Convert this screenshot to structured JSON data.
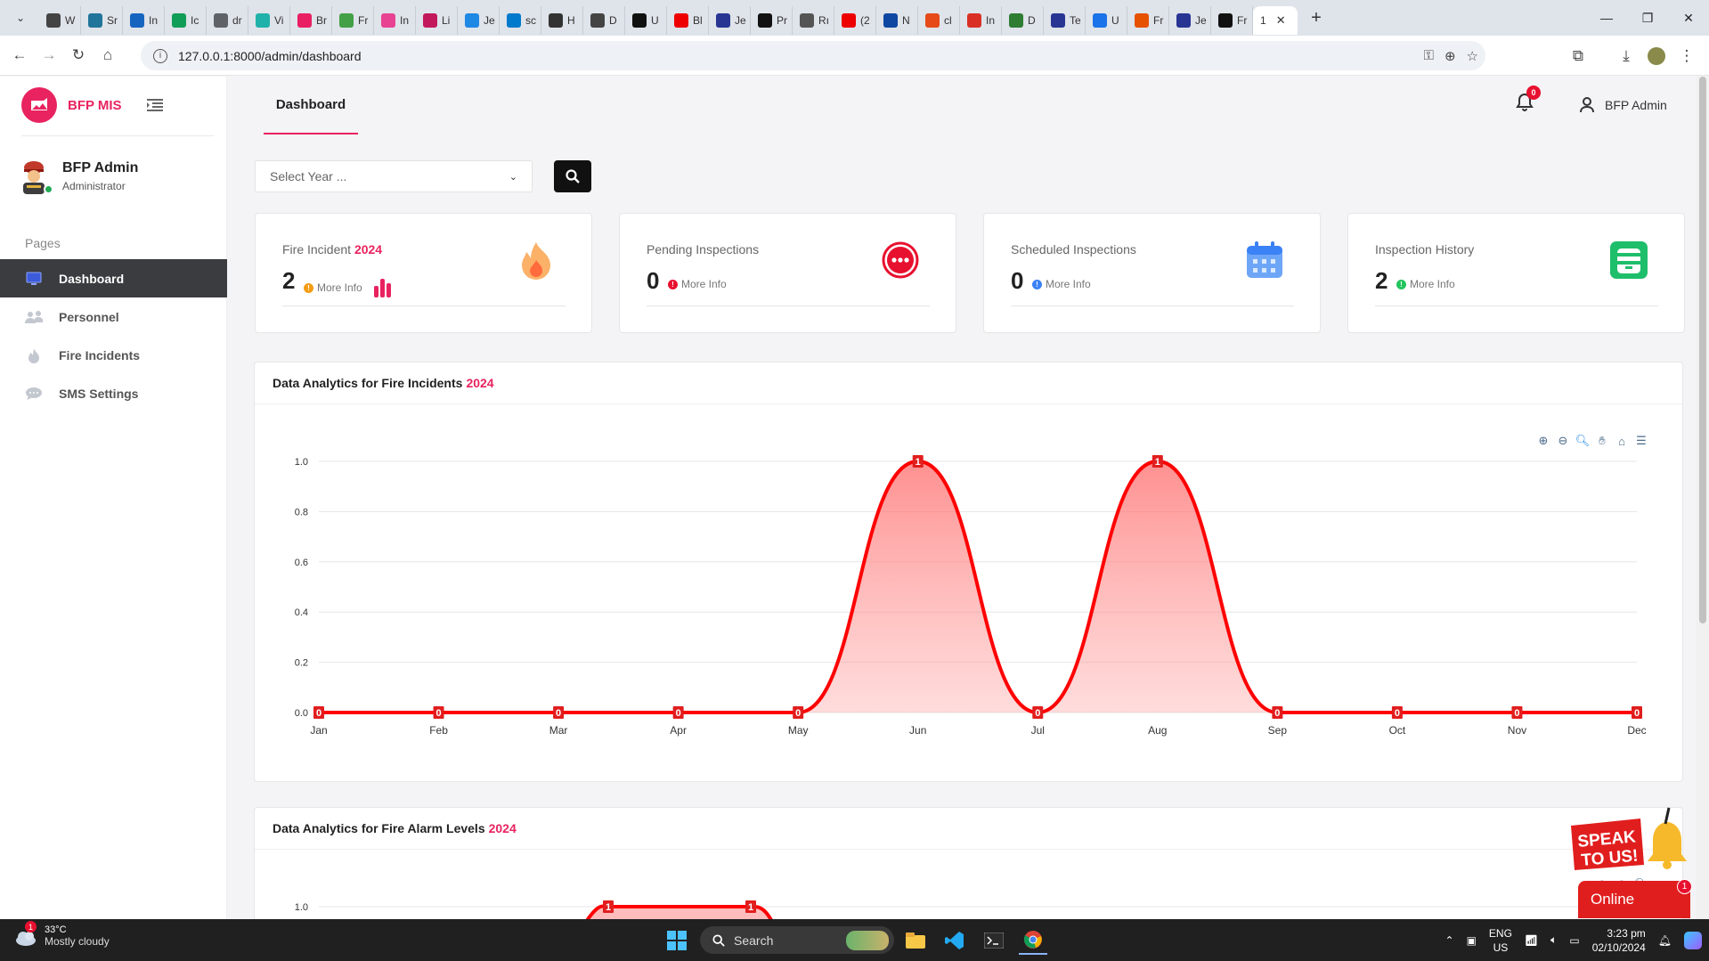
{
  "browser": {
    "tabs": [
      {
        "label": "W",
        "color": "#444"
      },
      {
        "label": "Sr",
        "color": "#21759b"
      },
      {
        "label": "In",
        "color": "#1565c0"
      },
      {
        "label": "Ic",
        "color": "#0f9d58"
      },
      {
        "label": "dr",
        "color": "#5f6368"
      },
      {
        "label": "Vi",
        "color": "#20b2aa"
      },
      {
        "label": "Br",
        "color": "#e91e63"
      },
      {
        "label": "Fr",
        "color": "#43a047"
      },
      {
        "label": "In",
        "color": "#e84393"
      },
      {
        "label": "Li",
        "color": "#c2185b"
      },
      {
        "label": "Je",
        "color": "#1e88e5"
      },
      {
        "label": "sc",
        "color": "#007acc"
      },
      {
        "label": "H",
        "color": "#333"
      },
      {
        "label": "D",
        "color": "#444"
      },
      {
        "label": "U",
        "color": "#111"
      },
      {
        "label": "Bl",
        "color": "#e00"
      },
      {
        "label": "Je",
        "color": "#283593"
      },
      {
        "label": "Pr",
        "color": "#111"
      },
      {
        "label": "Rı",
        "color": "#555"
      },
      {
        "label": "(2",
        "color": "#e00"
      },
      {
        "label": "N",
        "color": "#0d47a1"
      },
      {
        "label": "cl",
        "color": "#e64a19"
      },
      {
        "label": "In",
        "color": "#d93025"
      },
      {
        "label": "D",
        "color": "#2e7d32"
      },
      {
        "label": "Te",
        "color": "#283593"
      },
      {
        "label": "U",
        "color": "#1a73e8"
      },
      {
        "label": "Fr",
        "color": "#e65100"
      },
      {
        "label": "Je",
        "color": "#283593"
      },
      {
        "label": "Fr",
        "color": "#111"
      }
    ],
    "active_tab_label": "1",
    "url": "127.0.0.1:8000/admin/dashboard"
  },
  "sidebar": {
    "brand": "BFP MIS",
    "user_name": "BFP Admin",
    "user_role": "Administrator",
    "section_label": "Pages",
    "items": [
      {
        "label": "Dashboard",
        "icon": "monitor-icon"
      },
      {
        "label": "Personnel",
        "icon": "users-icon"
      },
      {
        "label": "Fire Incidents",
        "icon": "fire-icon"
      },
      {
        "label": "SMS Settings",
        "icon": "chat-icon"
      }
    ]
  },
  "header": {
    "tab": "Dashboard",
    "notification_count": "0",
    "user": "BFP Admin"
  },
  "filter": {
    "year_placeholder": "Select Year ..."
  },
  "cards": [
    {
      "title": "Fire Incident ",
      "year": "2024",
      "value": "2",
      "more": "More Info",
      "dot_color": "#f39c12",
      "icon": "flame-icon"
    },
    {
      "title": "Pending Inspections",
      "year": "",
      "value": "0",
      "more": "More Info",
      "dot_color": "#e8102f",
      "icon": "ellipsis-circle-icon"
    },
    {
      "title": "Scheduled Inspections",
      "year": "",
      "value": "0",
      "more": "More Info",
      "dot_color": "#3b82f6",
      "icon": "calendar-icon"
    },
    {
      "title": "Inspection History",
      "year": "",
      "value": "2",
      "more": "More Info",
      "dot_color": "#22c55e",
      "icon": "history-icon"
    }
  ],
  "panels": {
    "incidents_title": "Data Analytics for Fire Incidents",
    "alarm_title": "Data Analytics for Fire Alarm Levels",
    "year": "2024"
  },
  "chart_data": [
    {
      "type": "area",
      "title": "Data Analytics for Fire Incidents 2024",
      "categories": [
        "Jan",
        "Feb",
        "Mar",
        "Apr",
        "May",
        "Jun",
        "Jul",
        "Aug",
        "Sep",
        "Oct",
        "Nov",
        "Dec"
      ],
      "values": [
        0,
        0,
        0,
        0,
        0,
        1,
        0,
        1,
        0,
        0,
        0,
        0
      ],
      "ylim": [
        0,
        1
      ],
      "yticks": [
        "0.0",
        "0.2",
        "0.4",
        "0.6",
        "0.8",
        "1.0"
      ],
      "color": "#ff0000",
      "grid": true
    },
    {
      "type": "area",
      "title": "Data Analytics for Fire Alarm Levels 2024",
      "ylim": [
        0,
        1
      ],
      "yticks": [
        "1.0"
      ],
      "visible_labels": [
        "1",
        "1"
      ],
      "color": "#ff0000"
    }
  ],
  "widget": {
    "speak_line1": "SPEAK",
    "speak_line2": "TO US!",
    "online": "Online",
    "badge": "1"
  },
  "taskbar": {
    "temp": "33°C",
    "weather": "Mostly cloudy",
    "weather_badge": "1",
    "search": "Search",
    "lang1": "ENG",
    "lang2": "US",
    "time": "3:23 pm",
    "date": "02/10/2024"
  }
}
